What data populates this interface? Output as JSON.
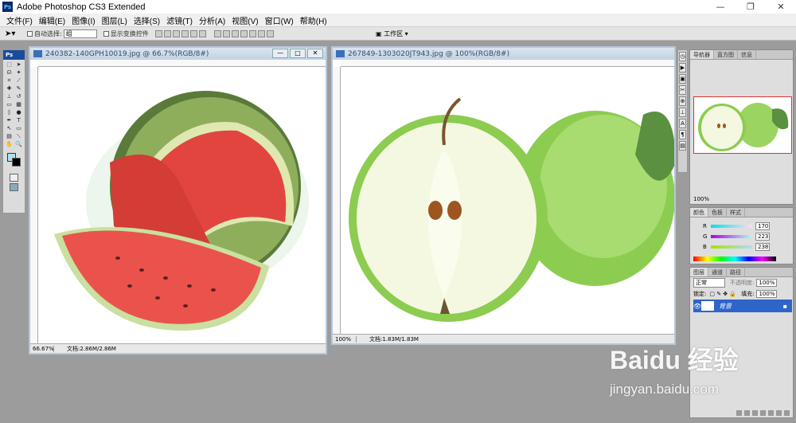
{
  "app": {
    "title": "Adobe Photoshop CS3 Extended",
    "logo_text": "Ps",
    "window_buttons": [
      "—",
      "❐",
      "✕"
    ]
  },
  "menu": [
    "文件(F)",
    "编辑(E)",
    "图像(I)",
    "图层(L)",
    "选择(S)",
    "滤镜(T)",
    "分析(A)",
    "视图(V)",
    "窗口(W)",
    "帮助(H)"
  ],
  "options": {
    "tool_icon": "move-icon",
    "auto_select_label": "自动选择:",
    "auto_select_value": "组",
    "show_transform_label": "显示变换控件",
    "workspace_label": "工作区 ▾"
  },
  "documents": [
    {
      "title": "240382-140GPH10019.jpg @ 66.7%(RGB/8#)",
      "zoom": "66.67%",
      "doc_size": "文档:2.86M/2.86M"
    },
    {
      "title": "267849-1303020JT943.jpg @ 100%(RGB/8#)",
      "zoom": "100%",
      "doc_size": "文档:1.83M/1.83M"
    }
  ],
  "panels": {
    "navigator": {
      "tabs": [
        "导航器",
        "直方图",
        "信息"
      ],
      "zoom": "100%"
    },
    "color": {
      "tabs": [
        "颜色",
        "色板",
        "样式"
      ],
      "channels": [
        {
          "label": "R",
          "value": "170",
          "color": "#a0c8d0"
        },
        {
          "label": "G",
          "value": "223",
          "color": "#90d8a0"
        },
        {
          "label": "B",
          "value": "238",
          "color": "#a0b8e8"
        }
      ]
    },
    "layers": {
      "tabs": [
        "图层",
        "通道",
        "路径"
      ],
      "blend_mode": "正常",
      "opacity_label": "不透明度:",
      "opacity": "100%",
      "lock_label": "锁定:",
      "fill_label": "填充:",
      "fill": "100%",
      "layer_name": "背景"
    }
  },
  "colors": {
    "accent": "#2f64c8",
    "foreground": "#aee0ee",
    "background": "#000000"
  },
  "watermark": {
    "brand": "Baidu 经验",
    "url": "jingyan.baidu.com"
  }
}
